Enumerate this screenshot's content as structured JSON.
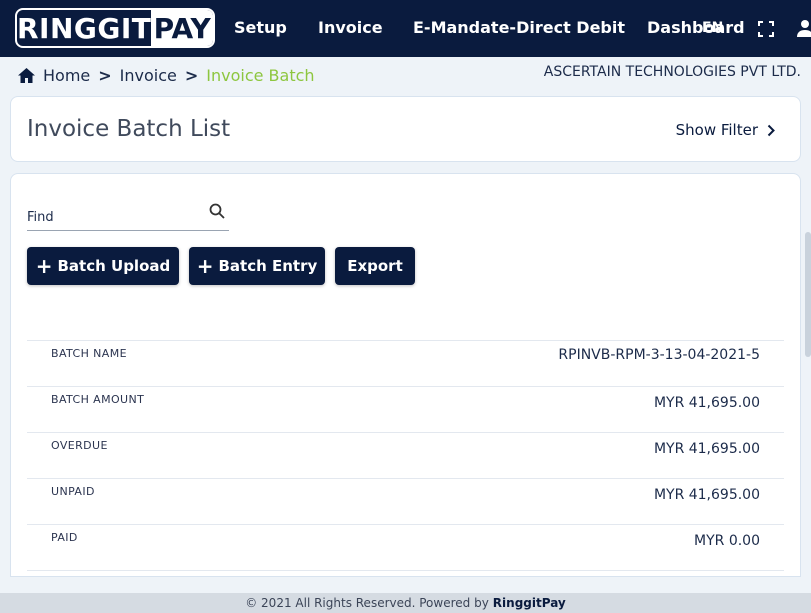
{
  "brand": {
    "logo_left": "RINGGIT",
    "logo_right": "PAY"
  },
  "nav": {
    "items": [
      "Setup",
      "Invoice",
      "E-Mandate-Direct Debit",
      "Dashboard"
    ],
    "overlap_text": "EN"
  },
  "breadcrumb": {
    "items": [
      "Home",
      "Invoice",
      "Invoice Batch"
    ]
  },
  "company_name": "ASCERTAIN TECHNOLOGIES PVT LTD.",
  "header": {
    "title": "Invoice Batch List",
    "show_filter_label": "Show Filter"
  },
  "search": {
    "placeholder": "Find",
    "value": ""
  },
  "actions": {
    "batch_upload_label": "Batch Upload",
    "batch_entry_label": "Batch Entry",
    "export_label": "Export"
  },
  "summary": [
    {
      "label": "BATCH NAME",
      "value": "RPINVB-RPM-3-13-04-2021-5"
    },
    {
      "label": "BATCH AMOUNT",
      "value": "MYR 41,695.00"
    },
    {
      "label": "OVERDUE",
      "value": "MYR 41,695.00"
    },
    {
      "label": "UNPAID",
      "value": "MYR 41,695.00"
    },
    {
      "label": "PAID",
      "value": "MYR 0.00"
    }
  ],
  "footer": {
    "text": "© 2021 All Rights Reserved. Powered by",
    "brand": "RinggitPay"
  },
  "colors": {
    "navbar": "#0a1b3e",
    "breadcrumb_active": "#8dc63f",
    "button": "#0a1b3e",
    "background": "#eef3f8"
  },
  "icons": [
    "home-icon",
    "search-icon",
    "fullscreen-icon",
    "user-icon",
    "chevron-right-icon",
    "plus-icon"
  ]
}
